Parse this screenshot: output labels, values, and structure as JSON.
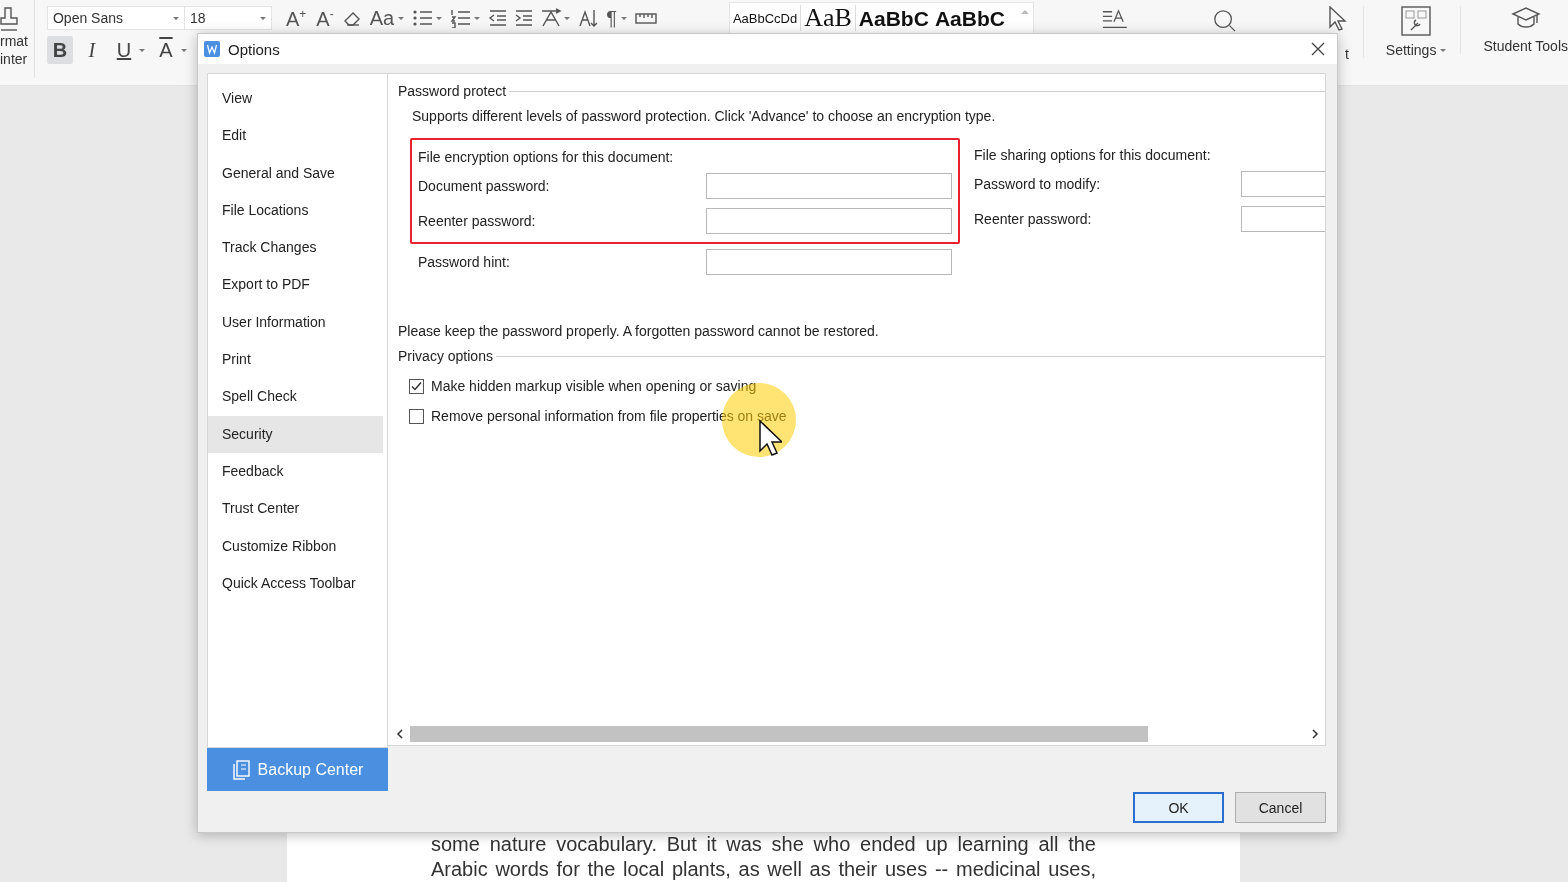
{
  "ribbon": {
    "format_painter_lines": [
      "rmat",
      "inter"
    ],
    "font_name": "Open Sans",
    "font_size": "18",
    "grow_font": "A$^{+}$",
    "shrink_font": "A$^{-}$",
    "change_case": "Aa",
    "paragraph_mark": "¶",
    "format_buttons": [
      {
        "label": "B",
        "kind": "bold",
        "selected": true
      },
      {
        "label": "I",
        "kind": "italic",
        "selected": false
      },
      {
        "label": "U",
        "kind": "underline",
        "selected": false
      },
      {
        "label": "A",
        "kind": "color",
        "selected": false
      }
    ],
    "style_samples": [
      {
        "text": "AaBbCcDd",
        "kind": "normal"
      },
      {
        "text": "AaB",
        "kind": "title"
      },
      {
        "text": "AaBbC",
        "kind": "heading1"
      },
      {
        "text": "AaBbC",
        "kind": "heading2"
      }
    ],
    "partial_label": "t",
    "settings": "Settings",
    "student_tools": "Student Tools"
  },
  "document": {
    "lines": [
      "some nature vocabulary. But it was she who ended up learning all the",
      "Arabic words for the local plants, as well as their uses -- medicinal uses,"
    ]
  },
  "dialog": {
    "title": "Options",
    "sidebar": {
      "items": [
        {
          "label": "View",
          "selected": false
        },
        {
          "label": "Edit",
          "selected": false
        },
        {
          "label": "General and Save",
          "selected": false
        },
        {
          "label": "File Locations",
          "selected": false
        },
        {
          "label": "Track Changes",
          "selected": false
        },
        {
          "label": "Export to PDF",
          "selected": false
        },
        {
          "label": "User Information",
          "selected": false
        },
        {
          "label": "Print",
          "selected": false
        },
        {
          "label": "Spell Check",
          "selected": false
        },
        {
          "label": "Security",
          "selected": true
        },
        {
          "label": "Feedback",
          "selected": false
        },
        {
          "label": "Trust Center",
          "selected": false
        },
        {
          "label": "Customize Ribbon",
          "selected": false
        },
        {
          "label": "Quick Access Toolbar",
          "selected": false
        }
      ],
      "backup_button": "Backup Center"
    },
    "password_protect": {
      "heading": "Password protect",
      "description": "Supports different levels of password protection. Click 'Advance' to choose an encryption type.",
      "encryption": {
        "heading": "File encryption options for this document:",
        "highlighted": true,
        "fields": [
          {
            "label": "Document password:"
          },
          {
            "label": "Reenter password:"
          }
        ]
      },
      "hint": {
        "label": "Password hint:"
      },
      "sharing": {
        "heading": "File sharing options for this document:",
        "fields": [
          {
            "label": "Password to modify:"
          },
          {
            "label": "Reenter password:"
          }
        ]
      },
      "note": "Please keep the password properly. A forgotten password cannot be restored."
    },
    "privacy": {
      "heading": "Privacy options",
      "options": [
        {
          "label": "Make hidden markup visible when opening or saving",
          "checked": true
        },
        {
          "label": "Remove personal information from file properties on save",
          "checked": false
        }
      ]
    },
    "buttons": [
      {
        "label": "OK",
        "kind": "default"
      },
      {
        "label": "Cancel",
        "kind": "normal"
      }
    ]
  }
}
